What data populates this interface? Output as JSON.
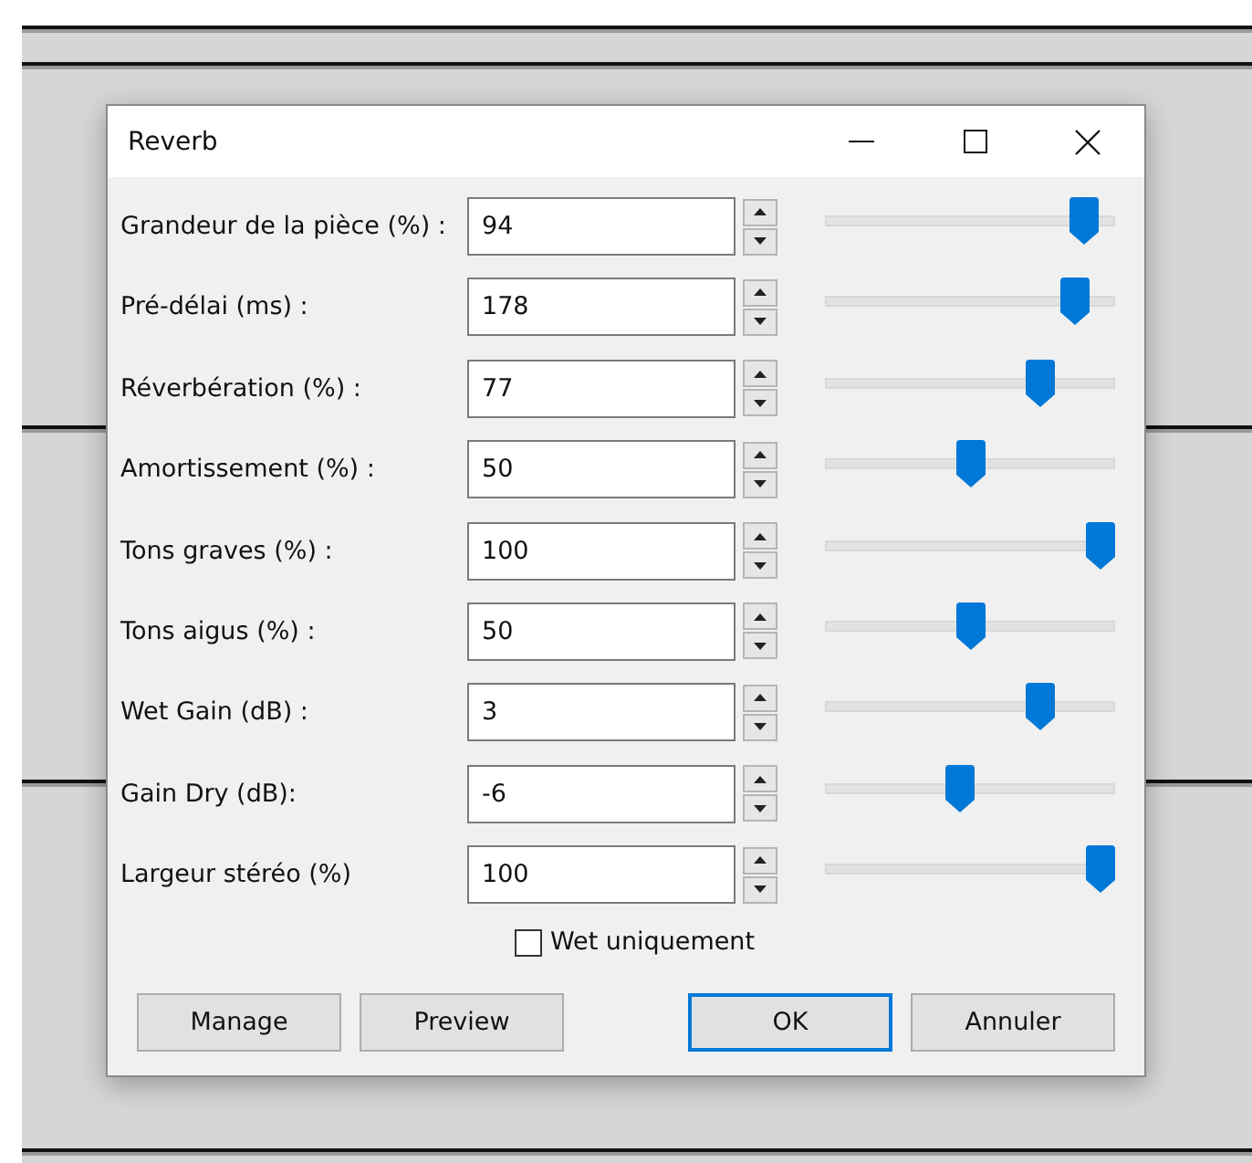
{
  "window": {
    "title": "Reverb"
  },
  "rows": [
    {
      "label": "Grandeur de la pièce (%) :",
      "value": "94",
      "level": 0.94
    },
    {
      "label": "Pré-délai (ms) :",
      "value": "178",
      "level": 0.9
    },
    {
      "label": "Réverbération (%) :",
      "value": "77",
      "level": 0.77
    },
    {
      "label": "Amortissement (%) :",
      "value": "50",
      "level": 0.5
    },
    {
      "label": "Tons graves (%) :",
      "value": "100",
      "level": 1
    },
    {
      "label": "Tons aigus (%) :",
      "value": "50",
      "level": 0.5
    },
    {
      "label": "Wet Gain (dB) :",
      "value": "3",
      "level": 0.77
    },
    {
      "label": "Gain Dry (dB):",
      "value": "-6",
      "level": 0.46
    },
    {
      "label": "Largeur stéréo (%)",
      "value": "100",
      "level": 1
    }
  ],
  "wet_only": {
    "label": "Wet uniquement",
    "checked": false
  },
  "buttons": [
    {
      "label": "Manage",
      "default": false
    },
    {
      "label": "Preview",
      "default": false
    },
    {
      "label": "OK",
      "default": true
    },
    {
      "label": "Annuler",
      "default": false
    }
  ]
}
